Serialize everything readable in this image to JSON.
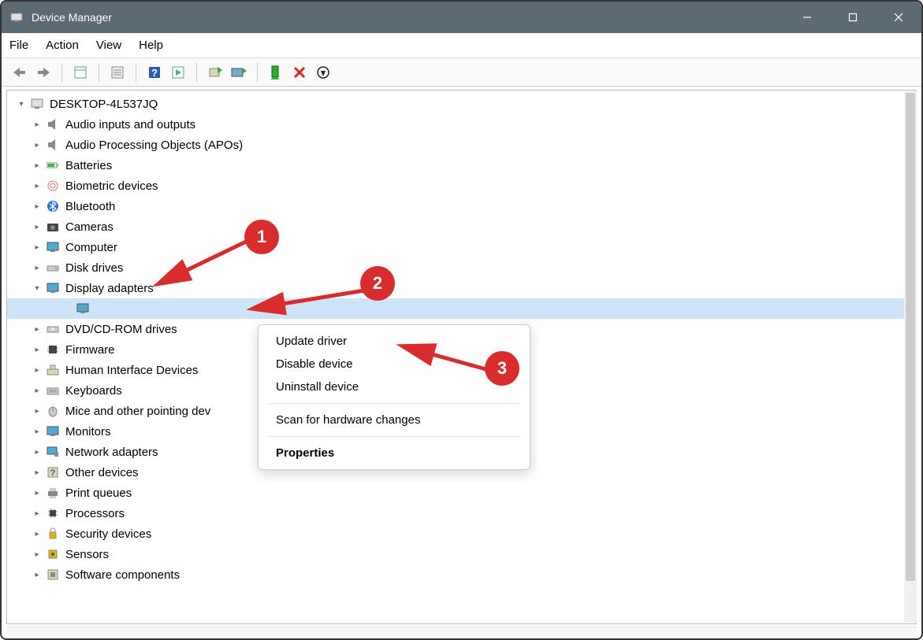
{
  "title": "Device Manager",
  "menus": {
    "file": "File",
    "action": "Action",
    "view": "View",
    "help": "Help"
  },
  "root": {
    "name": "DESKTOP-4L537JQ"
  },
  "categories": [
    {
      "label": "Audio inputs and outputs",
      "icon": "speaker",
      "expanded": false
    },
    {
      "label": "Audio Processing Objects (APOs)",
      "icon": "speaker",
      "expanded": false
    },
    {
      "label": "Batteries",
      "icon": "battery",
      "expanded": false
    },
    {
      "label": "Biometric devices",
      "icon": "fingerprint",
      "expanded": false
    },
    {
      "label": "Bluetooth",
      "icon": "bluetooth",
      "expanded": false
    },
    {
      "label": "Cameras",
      "icon": "camera",
      "expanded": false
    },
    {
      "label": "Computer",
      "icon": "monitor",
      "expanded": false
    },
    {
      "label": "Disk drives",
      "icon": "disk",
      "expanded": false
    },
    {
      "label": "Display adapters",
      "icon": "monitor",
      "expanded": true,
      "children": [
        {
          "label": "",
          "icon": "monitor",
          "selected": true
        }
      ]
    },
    {
      "label": "DVD/CD-ROM drives",
      "icon": "dvd",
      "expanded": false
    },
    {
      "label": "Firmware",
      "icon": "chip",
      "expanded": false
    },
    {
      "label": "Human Interface Devices",
      "icon": "hid",
      "expanded": false
    },
    {
      "label": "Keyboards",
      "icon": "keyboard",
      "expanded": false
    },
    {
      "label": "Mice and other pointing devices",
      "icon": "mouse",
      "expanded": false,
      "truncated": "Mice and other pointing dev"
    },
    {
      "label": "Monitors",
      "icon": "monitor",
      "expanded": false
    },
    {
      "label": "Network adapters",
      "icon": "network",
      "expanded": false
    },
    {
      "label": "Other devices",
      "icon": "question",
      "expanded": false
    },
    {
      "label": "Print queues",
      "icon": "printer",
      "expanded": false
    },
    {
      "label": "Processors",
      "icon": "cpu",
      "expanded": false
    },
    {
      "label": "Security devices",
      "icon": "security",
      "expanded": false
    },
    {
      "label": "Sensors",
      "icon": "sensor",
      "expanded": false
    },
    {
      "label": "Software components",
      "icon": "software",
      "expanded": false
    }
  ],
  "context_menu": {
    "update_driver": "Update driver",
    "disable_device": "Disable device",
    "uninstall_device": "Uninstall device",
    "scan": "Scan for hardware changes",
    "properties": "Properties"
  },
  "annotations": {
    "badge1": "1",
    "badge2": "2",
    "badge3": "3"
  }
}
